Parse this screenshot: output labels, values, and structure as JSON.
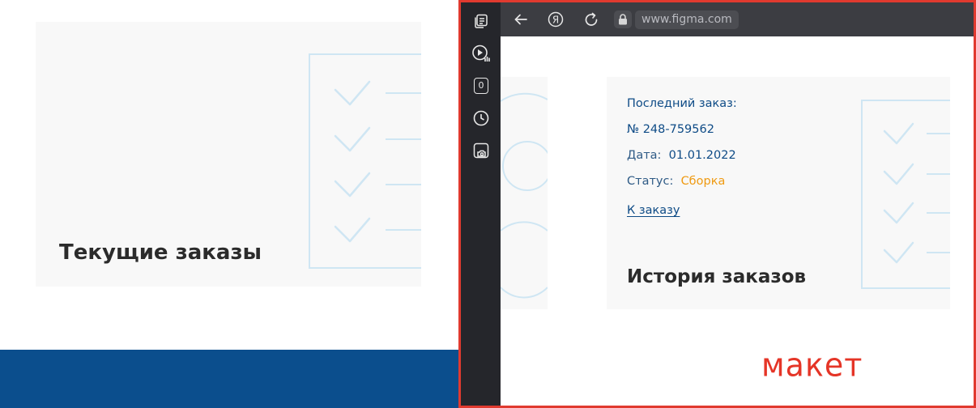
{
  "left_page": {
    "card_title": "Текущие заказы"
  },
  "browser": {
    "url": "www.figma.com",
    "side_panel": {
      "tab_counter": "0",
      "icons": [
        "collections-icon",
        "media-player-icon",
        "tab-counter",
        "history-icon",
        "screenshot-icon"
      ]
    },
    "toolbar_icons": [
      "back-arrow-icon",
      "yandex-icon",
      "reload-icon",
      "lock-icon"
    ]
  },
  "order_card": {
    "title": "Последний заказ:",
    "number": "№ 248-759562",
    "date_label": "Дата:",
    "date_value": "01.01.2022",
    "status_label": "Статус:",
    "status_value": "Сборка",
    "link": "К заказу",
    "history_title": "История заказов"
  },
  "annotation": {
    "text": "макет"
  },
  "colors": {
    "footer_blue": "#0b4e8d",
    "frame_red": "#e03a2f",
    "status_orange": "#ef9a12",
    "text_blue": "#0e4b86",
    "card_bg": "#f8f8f8",
    "sidebar_dark": "#25262b",
    "toolbar_dark": "#3c3d42"
  }
}
